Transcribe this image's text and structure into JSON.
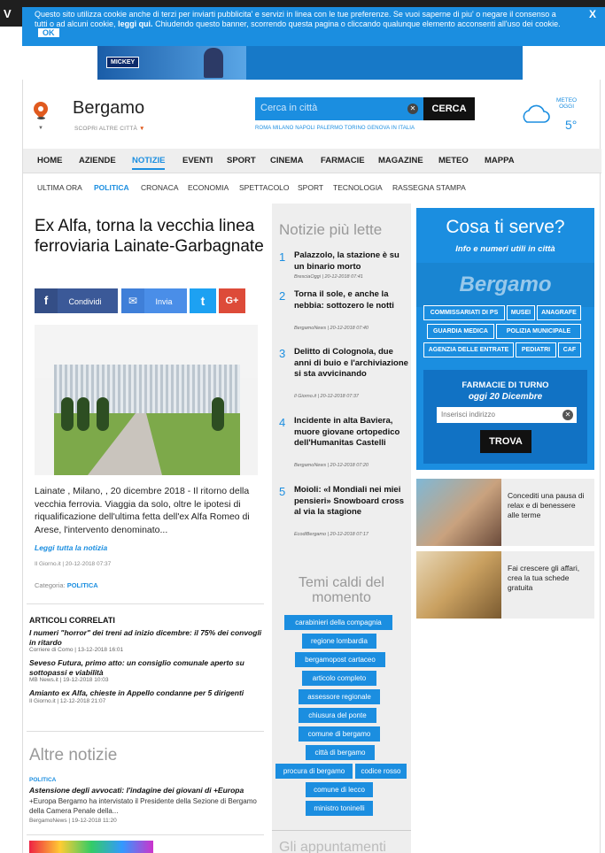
{
  "cookie_bar": {
    "edge_letter": "V",
    "text_before": "Questo sito utilizza cookie anche di terzi per inviarti pubblicita' e servizi in linea con le tue preferenze. Se vuoi saperne di piu' o negare il consenso a tutti o ad alcuni cookie, ",
    "link": "leggi qui.",
    "text_after": " Chiudendo questo banner, scorrendo questa pagina o cliccando qualunque elemento acconsenti all'uso dei cookie.",
    "ok_label": "OK",
    "close_label": "X"
  },
  "ad_banner": {
    "badge": "MICKEY"
  },
  "header": {
    "city": "Bergamo",
    "scopri": "SCOPRI ALTRE CITTÀ",
    "search_placeholder": "Cerca in città",
    "search_button": "CERCA",
    "cities": "ROMA   MILANO   NAPOLI   PALERMO   TORINO   GENOVA   IN ITALIA",
    "meteo_label": "METEO",
    "meteo_sub": "OGGI",
    "temperature": "5°"
  },
  "nav": [
    "HOME",
    "AZIENDE",
    "NOTIZIE",
    "EVENTI",
    "SPORT",
    "CINEMA",
    "FARMACIE",
    "MAGAZINE",
    "METEO",
    "MAPPA"
  ],
  "subnav": [
    "ULTIMA ORA",
    "POLITICA",
    "CRONACA",
    "ECONOMIA",
    "SPETTACOLO",
    "SPORT",
    "TECNOLOGIA",
    "RASSEGNA STAMPA"
  ],
  "article": {
    "title": "Ex Alfa, torna la vecchia linea ferroviaria Lainate-Garbagnate",
    "share": {
      "facebook": "Condividi",
      "messenger": "Invia",
      "twitter_glyph": "t",
      "gplus_glyph": "G+"
    },
    "lead": "Lainate , Milano, , 20 dicembre 2018 - Il ritorno della vecchia ferrovia. Viaggia da solo, oltre le ipotesi di riqualificazione dell'ultima fetta dell'ex Alfa Romeo di Arese, l'intervento denominato...",
    "read_more": "Leggi tutta la notizia",
    "meta": "Il Giorno.it | 20-12-2018 07:37",
    "category_label": "Categoria:",
    "category": "POLITICA"
  },
  "correlati": {
    "heading": "ARTICOLI CORRELATI",
    "items": [
      {
        "title": "I numeri \"horror\" dei treni ad inizio dicembre: il 75% dei convogli in ritardo",
        "meta": "Corriere di Como | 13-12-2018 16:01"
      },
      {
        "title": "Seveso Futura, primo atto: un consiglio comunale aperto su sottopassi e viabilità",
        "meta": "MB News.it | 19-12-2018 10:03"
      },
      {
        "title": "Amianto ex Alfa, chieste in Appello condanne per 5 dirigenti",
        "meta": "Il Giorno.it | 12-12-2018 21:07"
      }
    ]
  },
  "altre": {
    "heading": "Altre notizie",
    "category": "POLITICA",
    "title": "Astensione degli avvocati: l'indagine dei giovani di +Europa",
    "desc": "+Europa Bergamo ha intervistato il Presidente della Sezione di Bergamo della Camera Penale della...",
    "meta": "BergamoNews | 19-12-2018 11:20"
  },
  "piu_lette": {
    "heading": "Notizie più lette",
    "items": [
      {
        "n": "1",
        "title": "Palazzolo, la stazione è su un binario morto",
        "meta": "BresciaOggi | 20-12-2018 07:41"
      },
      {
        "n": "2",
        "title": "Torna il sole, e anche la nebbia: sottozero le notti",
        "meta": "BergamoNews | 20-12-2018 07:40"
      },
      {
        "n": "3",
        "title": "Delitto di Colognola, due anni di buio e l'archiviazione si sta avvicinando",
        "meta": "Il Giorno.it | 20-12-2018 07:37"
      },
      {
        "n": "4",
        "title": "Incidente in alta Baviera, muore giovane ortopedico dell'Humanitas Castelli",
        "meta": "BergamoNews | 20-12-2018 07:20"
      },
      {
        "n": "5",
        "title": "Moioli: «I Mondiali nei miei pensieri» Snowboard cross al via la stagione",
        "meta": "EcodiBergamo | 20-12-2018 07:17"
      }
    ]
  },
  "temi": {
    "heading": "Temi caldi del momento",
    "tags": [
      "carabinieri della compagnia",
      "regione lombardia",
      "bergamopost cartaceo",
      "articolo completo",
      "assessore regionale",
      "chiusura del ponte",
      "comune di bergamo",
      "città di bergamo",
      "procura di bergamo",
      "codice rosso",
      "comune di lecco",
      "ministro toninelli"
    ]
  },
  "gli_appuntamenti": "Gli appuntamenti",
  "cosa": {
    "heading": "Cosa ti serve?",
    "subheading": "Info e numeri utili in città",
    "bg_word": "Bergamo",
    "buttons": [
      "COMMISSARIATI DI PS",
      "MUSEI",
      "ANAGRAFE",
      "GUARDIA MEDICA",
      "POLIZIA MUNICIPALE",
      "AGENZIA DELLE ENTRATE",
      "PEDIATRI",
      "CAF"
    ]
  },
  "farmacie": {
    "title": "FARMACIE DI TURNO",
    "subtitle": "oggi 20 Dicembre",
    "placeholder": "Inserisci indirizzo",
    "button": "TROVA"
  },
  "ads": [
    {
      "text": "Concediti una pausa di relax e di benessere alle terme"
    },
    {
      "text": "Fai crescere gli affari, crea la tua schede gratuita"
    }
  ],
  "colors": {
    "accent": "#1b8ee0",
    "cta_dark": "#111111",
    "orange": "#e05a1f"
  }
}
